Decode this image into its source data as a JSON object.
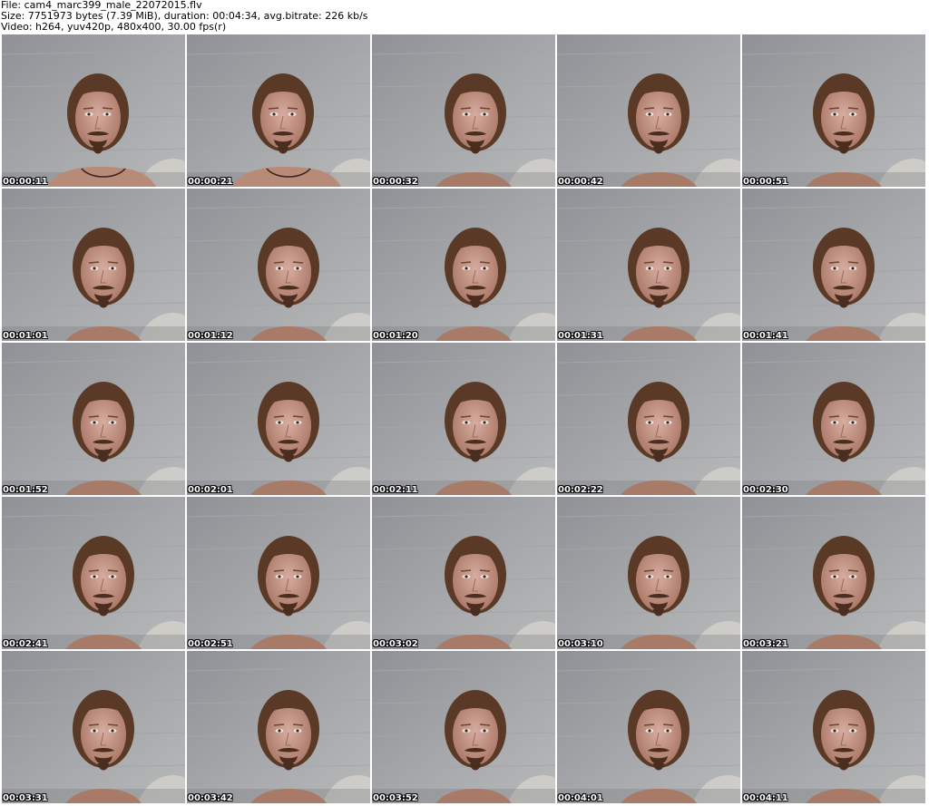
{
  "header": {
    "file_line": "File: cam4_marc399_male_22072015.flv",
    "size_line": "Size: 7751973 bytes (7.39 MiB), duration: 00:04:34, avg.bitrate: 226 kb/s",
    "video_line": "Video: h264, yuv420p, 480x400, 30.00 fps(r)"
  },
  "thumbnails": [
    {
      "time": "00:00:11",
      "shirtless": true
    },
    {
      "time": "00:00:21",
      "shirtless": true
    },
    {
      "time": "00:00:32",
      "shirtless": false
    },
    {
      "time": "00:00:42",
      "shirtless": false
    },
    {
      "time": "00:00:51",
      "shirtless": false
    },
    {
      "time": "00:01:01",
      "shirtless": false
    },
    {
      "time": "00:01:12",
      "shirtless": false
    },
    {
      "time": "00:01:20",
      "shirtless": false
    },
    {
      "time": "00:01:31",
      "shirtless": false
    },
    {
      "time": "00:01:41",
      "shirtless": false
    },
    {
      "time": "00:01:52",
      "shirtless": false
    },
    {
      "time": "00:02:01",
      "shirtless": false
    },
    {
      "time": "00:02:11",
      "shirtless": false
    },
    {
      "time": "00:02:22",
      "shirtless": false
    },
    {
      "time": "00:02:30",
      "shirtless": false
    },
    {
      "time": "00:02:41",
      "shirtless": false
    },
    {
      "time": "00:02:51",
      "shirtless": false
    },
    {
      "time": "00:03:02",
      "shirtless": false
    },
    {
      "time": "00:03:10",
      "shirtless": false
    },
    {
      "time": "00:03:21",
      "shirtless": false
    },
    {
      "time": "00:03:31",
      "shirtless": false
    },
    {
      "time": "00:03:42",
      "shirtless": false
    },
    {
      "time": "00:03:52",
      "shirtless": false
    },
    {
      "time": "00:04:01",
      "shirtless": false
    },
    {
      "time": "00:04:11",
      "shirtless": false
    }
  ],
  "colors": {
    "background": "#ffffff",
    "wall": "#9b9da0",
    "hair": "#5a3a26",
    "skin": "#c89a86",
    "beard": "#4b2d20",
    "text": "#000000",
    "timestamp_text": "#ffffff"
  }
}
